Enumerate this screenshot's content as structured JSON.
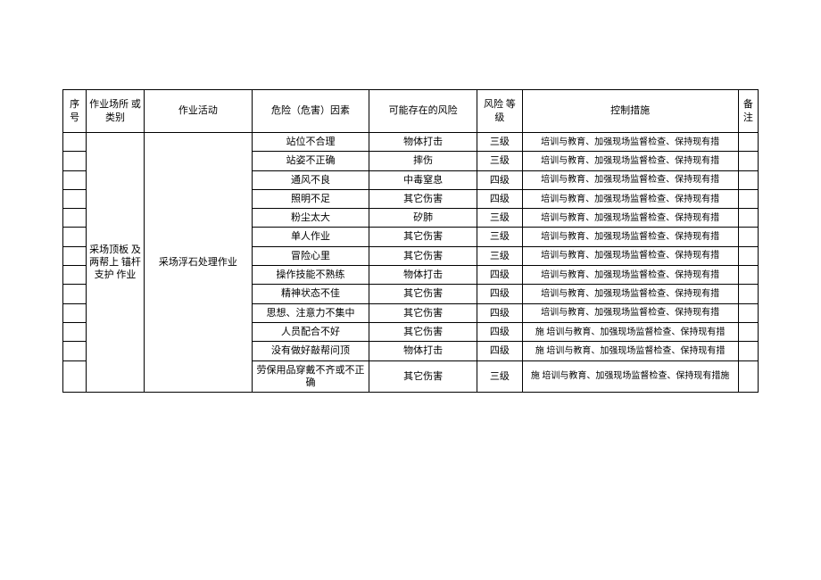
{
  "headers": {
    "seq": "序 号",
    "place": "作业场所 或类别",
    "activity": "作业活动",
    "hazard": "危险（危害）因素",
    "risk": "可能存在的风险",
    "level": "风险 等级",
    "measure": "控制措施",
    "remark": "备注"
  },
  "merged": {
    "place": "采场顶板 及两帮上 锚杆支护 作业",
    "activity": "采场浮石处理作业"
  },
  "rows": [
    {
      "hazard": "站位不合理",
      "risk": "物体打击",
      "level": "三级",
      "measure": "培训与教育、加强现场监督检查、保持现有措"
    },
    {
      "hazard": "站姿不正确",
      "risk": "摔伤",
      "level": "三级",
      "measure": "培训与教育、加强现场监督检查、保持现有措"
    },
    {
      "hazard": "通风不良",
      "risk": "中毒窒息",
      "level": "四级",
      "measure": "培训与教育、加强现场监督检查、保持现有措"
    },
    {
      "hazard": "照明不足",
      "risk": "其它伤害",
      "level": "四级",
      "measure": "培训与教育、加强现场监督检查、保持现有措"
    },
    {
      "hazard": "粉尘太大",
      "risk": "矽肺",
      "level": "三级",
      "measure": "培训与教育、加强现场监督检查、保持现有措"
    },
    {
      "hazard": "单人作业",
      "risk": "其它伤害",
      "level": "三级",
      "measure": "培训与教育、加强现场监督检查、保持现有措"
    },
    {
      "hazard": "冒险心里",
      "risk": "其它伤害",
      "level": "三级",
      "measure": "培训与教育、加强现场监督检查、保持现有措"
    },
    {
      "hazard": "操作技能不熟练",
      "risk": "物体打击",
      "level": "四级",
      "measure": "培训与教育、加强现场监督检查、保持现有措"
    },
    {
      "hazard": "精神状态不佳",
      "risk": "其它伤害",
      "level": "四级",
      "measure": "培训与教育、加强现场监督检查、保持现有措"
    },
    {
      "hazard": "思想、注意力不集中",
      "risk": "其它伤害",
      "level": "四级",
      "measure": "培训与教育、加强现场监督检查、保持现有措"
    },
    {
      "hazard": "人员配合不好",
      "risk": "其它伤害",
      "level": "四级",
      "measure": "施\n培训与教育、加强现场监督检查、保持现有措"
    },
    {
      "hazard": "没有做好敲帮问顶",
      "risk": "物体打击",
      "level": "四级",
      "measure": "施\n培训与教育、加强现场监督检查、保持现有措"
    },
    {
      "hazard": "劳保用品穿戴不齐或不正确",
      "risk": "其它伤害",
      "level": "三级",
      "measure": "施\n培训与教育、加强现场监督检查、保持现有措施"
    }
  ]
}
